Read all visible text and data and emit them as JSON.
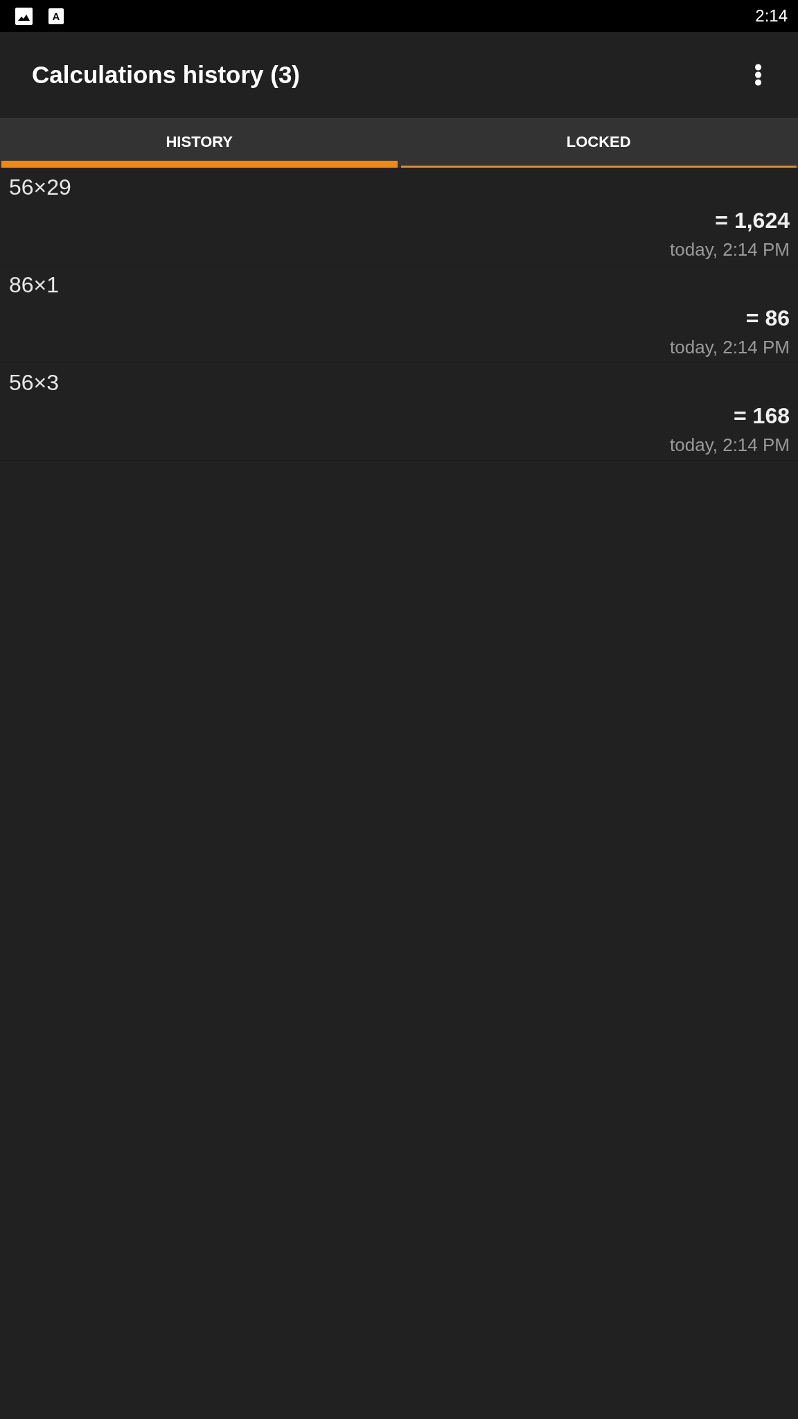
{
  "status_bar": {
    "notification_letter": "A",
    "time": "2:14"
  },
  "app_bar": {
    "title": "Calculations history (3)"
  },
  "tabs": [
    {
      "label": "HISTORY",
      "selected": true
    },
    {
      "label": "LOCKED",
      "selected": false
    }
  ],
  "history": [
    {
      "expression": "56×29",
      "result": "= 1,624",
      "time": "today, 2:14 PM"
    },
    {
      "expression": "86×1",
      "result": "= 86",
      "time": "today, 2:14 PM"
    },
    {
      "expression": "56×3",
      "result": "= 168",
      "time": "today, 2:14 PM"
    }
  ]
}
